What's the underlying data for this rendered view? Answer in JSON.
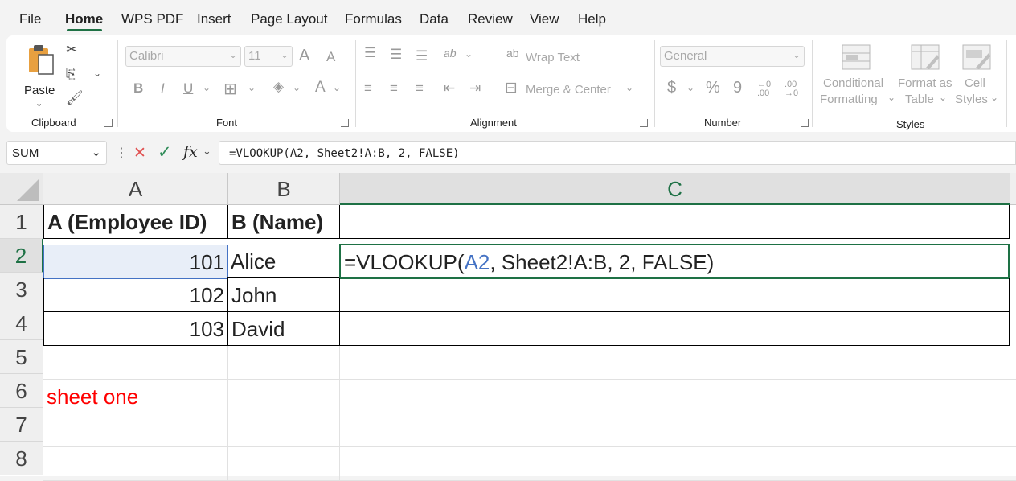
{
  "menu": {
    "tabs": [
      "File",
      "Home",
      "WPS PDF",
      "Insert",
      "Page Layout",
      "Formulas",
      "Data",
      "Review",
      "View",
      "Help"
    ],
    "active": "Home"
  },
  "ribbon": {
    "clipboard": {
      "paste_label": "Paste",
      "group_label": "Clipboard"
    },
    "font": {
      "font_name": "Calibri",
      "font_size": "11",
      "bold": "B",
      "italic": "I",
      "underline": "U",
      "font_color_glyph": "A",
      "grow_glyph": "A",
      "shrink_glyph": "A",
      "group_label": "Font"
    },
    "alignment": {
      "wrap_text": "Wrap Text",
      "merge_center": "Merge & Center",
      "group_label": "Alignment",
      "orientation_glyph": "ab"
    },
    "number": {
      "format": "General",
      "currency": "$",
      "percent": "%",
      "comma": "9",
      "inc_decimal": "←0 .00",
      "dec_decimal": ".00 →0",
      "group_label": "Number"
    },
    "styles": {
      "conditional_formatting": [
        "Conditional",
        "Formatting"
      ],
      "format_as_table": [
        "Format as",
        "Table"
      ],
      "cell_styles": [
        "Cell",
        "Styles"
      ],
      "group_label": "Styles"
    }
  },
  "formula_bar": {
    "name_box": "SUM",
    "cancel_glyph": "✕",
    "enter_glyph": "✓",
    "fx_label": "fx",
    "formula": "=VLOOKUP(A2, Sheet2!A:B, 2, FALSE)"
  },
  "sheet": {
    "columns": [
      "A",
      "B",
      "C"
    ],
    "rows": [
      "1",
      "2",
      "3",
      "4",
      "5",
      "6",
      "7",
      "8"
    ],
    "cells": {
      "A1": "A (Employee ID)",
      "B1": "B (Name)",
      "A2": "101",
      "B2": "Alice",
      "C2_prefix": "=VLOOKUP(",
      "C2_ref": "A2",
      "C2_suffix": ", Sheet2!A:B, 2, FALSE)",
      "A3": "102",
      "B3": "John",
      "A4": "103",
      "B4": "David",
      "A6": "sheet one"
    }
  },
  "colors": {
    "accent": "#1e7145",
    "reference": "#4472c4",
    "red_text": "#ff0000",
    "cancel": "#e05050",
    "enter": "#2e8b57"
  }
}
